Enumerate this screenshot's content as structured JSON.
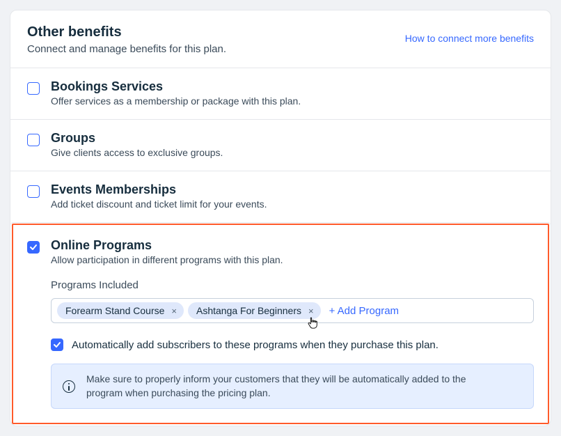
{
  "header": {
    "title": "Other benefits",
    "subtitle": "Connect and manage benefits for this plan.",
    "link": "How to connect more benefits"
  },
  "benefits": {
    "bookings": {
      "title": "Bookings Services",
      "desc": "Offer services as a membership or package with this plan."
    },
    "groups": {
      "title": "Groups",
      "desc": "Give clients access to exclusive groups."
    },
    "events": {
      "title": "Events Memberships",
      "desc": "Add ticket discount and ticket limit for your events."
    },
    "programs": {
      "title": "Online Programs",
      "desc": "Allow participation in different programs with this plan.",
      "section_label": "Programs Included",
      "chips": [
        "Forearm Stand Course",
        "Ashtanga For Beginners"
      ],
      "add_label": "+ Add Program",
      "auto_add_label": "Automatically add subscribers to these programs when they purchase this plan.",
      "info_text": "Make sure to properly inform your customers that they will be automatically added to the program when purchasing the pricing plan."
    }
  }
}
